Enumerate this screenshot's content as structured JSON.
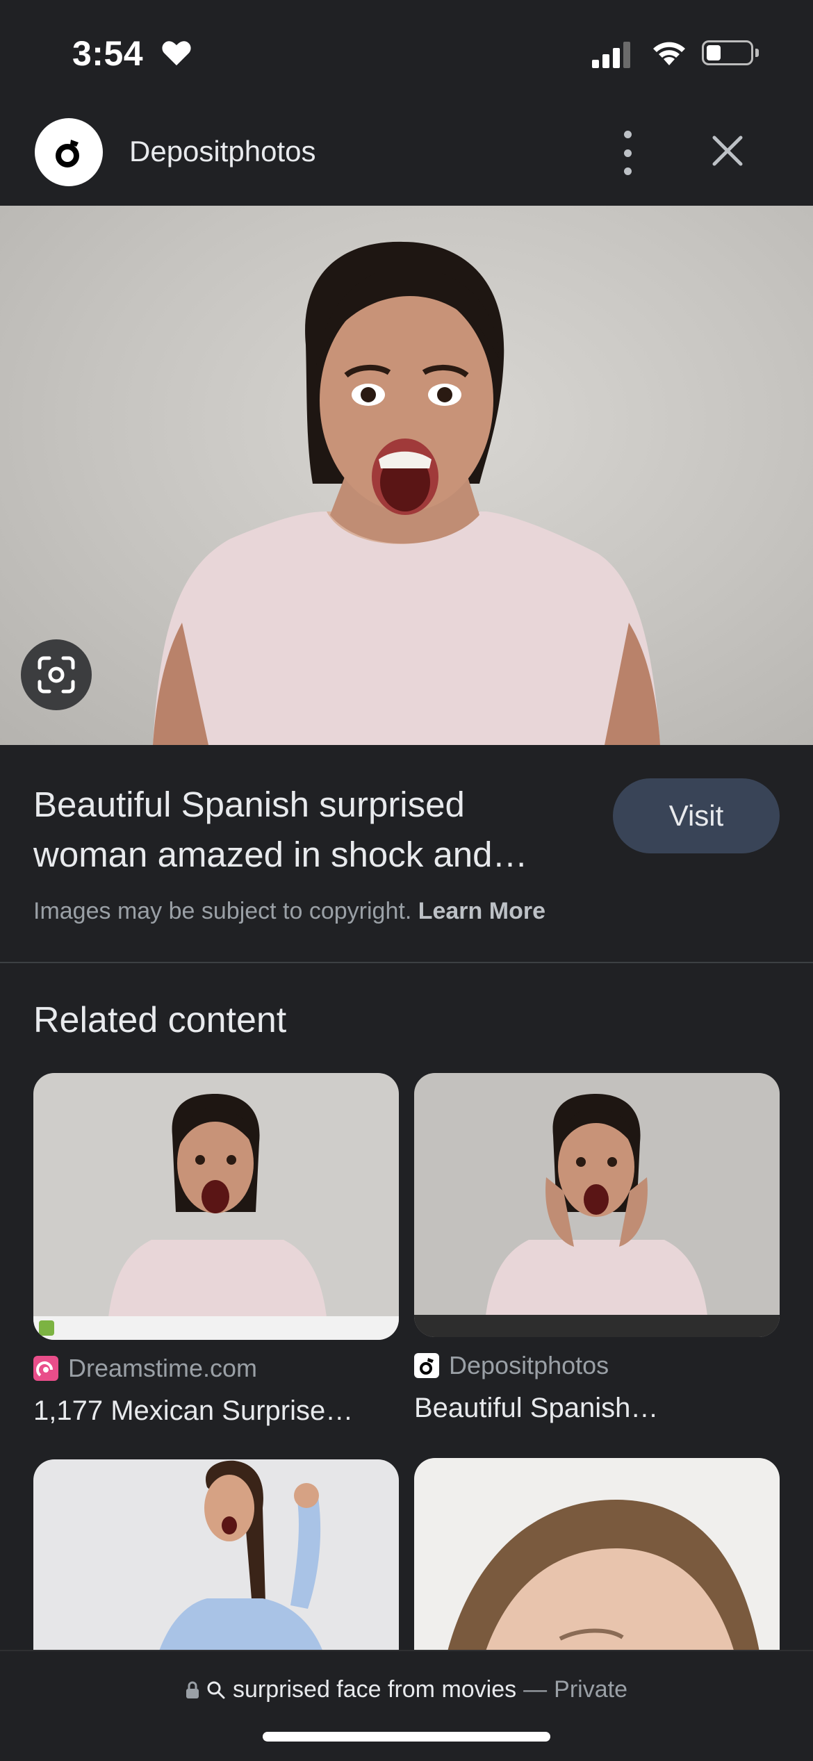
{
  "status_bar": {
    "time": "3:54"
  },
  "header": {
    "site_name": "Depositphotos"
  },
  "result": {
    "title_line1": "Beautiful Spanish surprised",
    "title_line2": "woman amazed in shock and…",
    "visit_label": "Visit",
    "copyright_text": "Images may be subject to copyright.",
    "learn_more_label": "Learn More"
  },
  "related": {
    "heading": "Related content",
    "cards": [
      {
        "source": "Dreamstime.com",
        "title": "1,177 Mexican Surprise…"
      },
      {
        "source": "Depositphotos",
        "title": "Beautiful Spanish…"
      }
    ]
  },
  "bottom": {
    "query": "surprised face from movies",
    "separator": "—",
    "mode": "Private"
  },
  "colors": {
    "background": "#202124",
    "visit_button": "#394457",
    "secondary_text": "#9aa0a6"
  }
}
